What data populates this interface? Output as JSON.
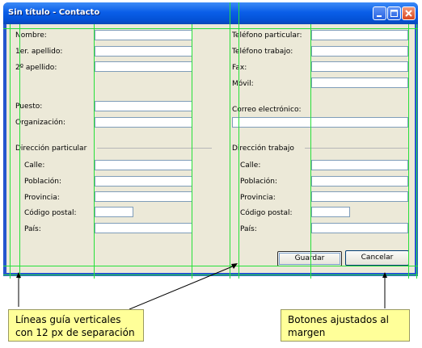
{
  "window": {
    "title": "Sin título - Contacto"
  },
  "left_fields": [
    {
      "label": "Nombre:"
    },
    {
      "label": "1er. apellido:"
    },
    {
      "label": "2º apellido:"
    },
    {
      "label": "Puesto:"
    },
    {
      "label": "Organización:"
    }
  ],
  "right_fields": [
    {
      "label": "Teléfono particular:"
    },
    {
      "label": "Teléfono trabajo:"
    },
    {
      "label": "Fax:"
    },
    {
      "label": "Móvil:"
    },
    {
      "label": "Correo electrónico:"
    }
  ],
  "home_section": {
    "title": "Dirección particular",
    "fields": [
      "Calle:",
      "Población:",
      "Provincia:",
      "Código postal:",
      "País:"
    ]
  },
  "work_section": {
    "title": "Dirección trabajo",
    "fields": [
      "Calle:",
      "Población:",
      "Provincia:",
      "Código postal:",
      "País:"
    ]
  },
  "buttons": {
    "save": "Guardar",
    "cancel": "Cancelar"
  },
  "callouts": {
    "guides": "Líneas guía verticales con 12 px de separación",
    "buttons": "Botones ajustados al margen"
  },
  "colors": {
    "guide": "#27e03a",
    "titlebar": "#0a5ee8",
    "client": "#ece9d8",
    "callout": "#ffff99"
  },
  "icons": [
    "minimize-icon",
    "maximize-icon",
    "close-icon"
  ]
}
